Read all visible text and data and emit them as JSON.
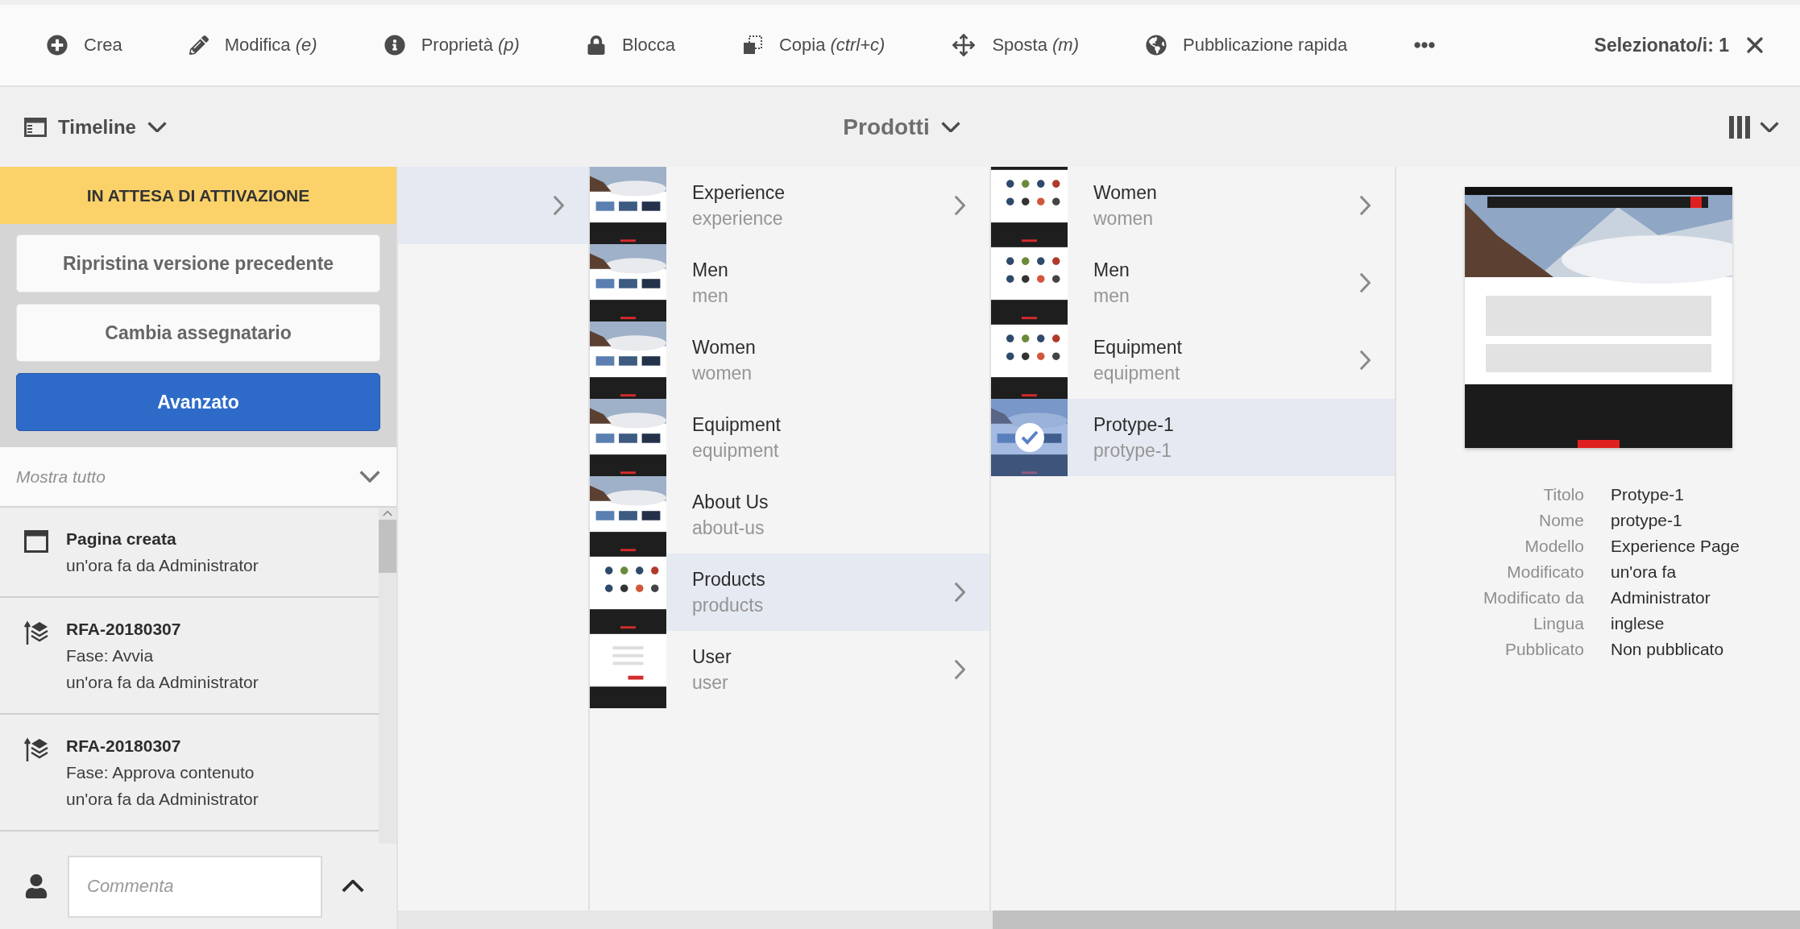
{
  "toolbar": {
    "actions": [
      {
        "kind": "create",
        "label": "Crea"
      },
      {
        "kind": "edit",
        "label": "Modifica *(e)*"
      },
      {
        "kind": "properties",
        "label": "Proprietà *(p)*"
      },
      {
        "kind": "lock",
        "label": "Blocca"
      },
      {
        "kind": "copy",
        "label": "Copia *(ctrl+c)*"
      },
      {
        "kind": "move",
        "label": "Sposta *(m)*"
      },
      {
        "kind": "publish",
        "label": "Pubblicazione rapida"
      },
      {
        "kind": "more"
      }
    ],
    "selection": "Selezionato/i: 1"
  },
  "header": {
    "rail": "Timeline",
    "title": "Prodotti"
  },
  "sidebar": {
    "status": "IN ATTESA DI ATTIVAZIONE",
    "buttons": [
      {
        "label": "Ripristina versione precedente",
        "primary": false
      },
      {
        "label": "Cambia assegnatario",
        "primary": false
      },
      {
        "label": "Avanzato",
        "primary": true
      }
    ],
    "filter": "Mostra tutto",
    "events": [
      {
        "kind": "page",
        "title": "Pagina creata",
        "lines": [
          "un'ora fa da Administrator"
        ]
      },
      {
        "kind": "workflow",
        "title": "RFA-20180307",
        "lines": [
          "Fase: Avvia",
          "un'ora fa da Administrator"
        ]
      },
      {
        "kind": "workflow",
        "title": "RFA-20180307",
        "lines": [
          "Fase: Approva contenuto",
          "un'ora fa da Administrator"
        ]
      }
    ],
    "comment": {
      "placeholder": "Commenta"
    }
  },
  "columns": [
    {
      "items": [
        {
          "selected": true,
          "has_children": true
        }
      ]
    },
    {
      "items": [
        {
          "title": "Experience",
          "name": "experience",
          "selected": false,
          "has_children": true
        },
        {
          "title": "Men",
          "name": "men",
          "selected": false,
          "has_children": false
        },
        {
          "title": "Women",
          "name": "women",
          "selected": false,
          "has_children": false
        },
        {
          "title": "Equipment",
          "name": "equipment",
          "selected": false,
          "has_children": false
        },
        {
          "title": "About Us",
          "name": "about-us",
          "selected": false,
          "has_children": false
        },
        {
          "title": "Products",
          "name": "products",
          "selected": true,
          "has_children": true
        },
        {
          "title": "User",
          "name": "user",
          "selected": false,
          "has_children": true
        }
      ]
    },
    {
      "items": [
        {
          "title": "Women",
          "name": "women",
          "selected": false,
          "checked": false,
          "has_children": true
        },
        {
          "title": "Men",
          "name": "men",
          "selected": false,
          "checked": false,
          "has_children": true
        },
        {
          "title": "Equipment",
          "name": "equipment",
          "selected": false,
          "checked": false,
          "has_children": true
        },
        {
          "title": "Protype-1",
          "name": "protype-1",
          "selected": true,
          "checked": true,
          "has_children": false
        }
      ]
    }
  ],
  "preview": {
    "properties": [
      {
        "label": "Titolo",
        "value": "Protype-1"
      },
      {
        "label": "Nome",
        "value": "protype-1"
      },
      {
        "label": "Modello",
        "value": "Experience Page"
      },
      {
        "label": "Modificato",
        "value": "un'ora fa"
      },
      {
        "label": "Modificato da",
        "value": "Administrator"
      },
      {
        "label": "Lingua",
        "value": "inglese"
      },
      {
        "label": "Pubblicato",
        "value": "Non pubblicato"
      }
    ]
  }
}
